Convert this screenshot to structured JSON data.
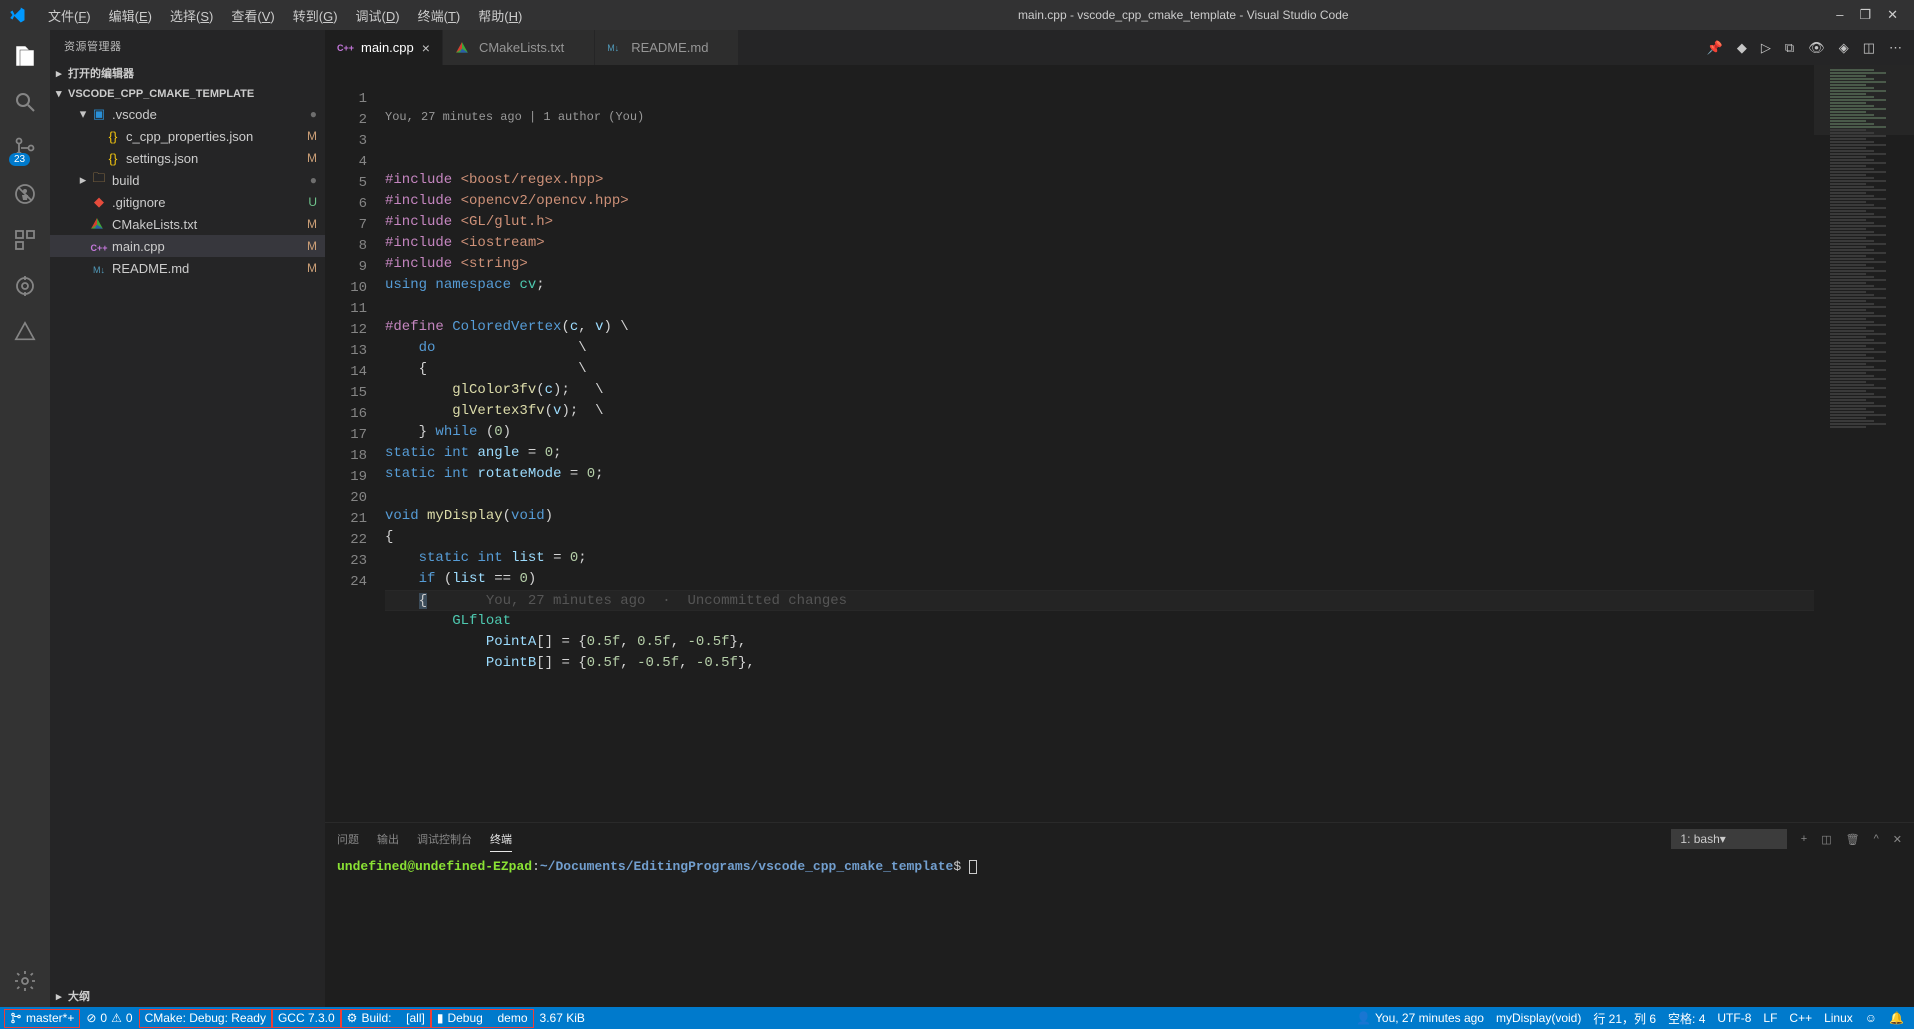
{
  "window": {
    "title": "main.cpp - vscode_cpp_cmake_template - Visual Studio Code"
  },
  "menubar": {
    "items": [
      {
        "pre": "文件(",
        "accel": "F",
        "post": ")"
      },
      {
        "pre": "编辑(",
        "accel": "E",
        "post": ")"
      },
      {
        "pre": "选择(",
        "accel": "S",
        "post": ")"
      },
      {
        "pre": "查看(",
        "accel": "V",
        "post": ")"
      },
      {
        "pre": "转到(",
        "accel": "G",
        "post": ")"
      },
      {
        "pre": "调试(",
        "accel": "D",
        "post": ")"
      },
      {
        "pre": "终端(",
        "accel": "T",
        "post": ")"
      },
      {
        "pre": "帮助(",
        "accel": "H",
        "post": ")"
      }
    ]
  },
  "activitybar": {
    "scm_badge": "23"
  },
  "sidebar": {
    "title": "资源管理器",
    "sections": {
      "open_editors": "打开的编辑器",
      "workspace": "VSCODE_CPP_CMAKE_TEMPLATE",
      "outline": "大纲"
    },
    "tree": [
      {
        "indent": 1,
        "chevron": "▾",
        "icon": "folder-vscode",
        "label": ".vscode",
        "badge": "●",
        "badgeClass": "dot"
      },
      {
        "indent": 2,
        "chevron": "",
        "icon": "json",
        "label": "c_cpp_properties.json",
        "badge": "M"
      },
      {
        "indent": 2,
        "chevron": "",
        "icon": "json",
        "label": "settings.json",
        "badge": "M"
      },
      {
        "indent": 1,
        "chevron": "▸",
        "icon": "folder",
        "label": "build",
        "badge": "●",
        "badgeClass": "dot"
      },
      {
        "indent": 1,
        "chevron": "",
        "icon": "git",
        "label": ".gitignore",
        "badge": "U",
        "badgeClass": "u"
      },
      {
        "indent": 1,
        "chevron": "",
        "icon": "cmake",
        "label": "CMakeLists.txt",
        "badge": "M"
      },
      {
        "indent": 1,
        "chevron": "",
        "icon": "cpp",
        "label": "main.cpp",
        "badge": "M",
        "selected": true
      },
      {
        "indent": 1,
        "chevron": "",
        "icon": "md",
        "label": "README.md",
        "badge": "M"
      }
    ]
  },
  "tabs": [
    {
      "icon": "cpp",
      "label": "main.cpp",
      "active": true,
      "close": true
    },
    {
      "icon": "cmake",
      "label": "CMakeLists.txt"
    },
    {
      "icon": "md",
      "label": "README.md"
    }
  ],
  "editor": {
    "codelens": "You, 27 minutes ago | 1 author (You)",
    "inline_blame": "You, 27 minutes ago  ·  Uncommitted changes",
    "lines_start": 1,
    "lines_end": 24,
    "code": [
      {
        "html": "<span class='tok-include'>#include</span> <span class='tok-string'>&lt;boost/regex.hpp&gt;</span>"
      },
      {
        "html": "<span class='tok-include'>#include</span> <span class='tok-string'>&lt;opencv2/opencv.hpp&gt;</span>"
      },
      {
        "html": "<span class='tok-include'>#include</span> <span class='tok-string'>&lt;GL/glut.h&gt;</span>"
      },
      {
        "html": "<span class='tok-include'>#include</span> <span class='tok-string'>&lt;iostream&gt;</span>"
      },
      {
        "html": "<span class='tok-include'>#include</span> <span class='tok-string'>&lt;string&gt;</span>"
      },
      {
        "html": "<span class='tok-keyword'>using</span> <span class='tok-keyword'>namespace</span> <span class='tok-type'>cv</span><span class='tok-punct'>;</span>"
      },
      {
        "html": ""
      },
      {
        "html": "<span class='tok-include'>#define</span> <span class='tok-macro'>ColoredVertex</span><span class='tok-punct'>(</span><span class='tok-var'>c</span><span class='tok-punct'>,</span> <span class='tok-var'>v</span><span class='tok-punct'>)</span> <span class='tok-punct'>\\</span>"
      },
      {
        "html": "    <span class='tok-keyword'>do</span>                 <span class='tok-punct'>\\</span>"
      },
      {
        "html": "    <span class='tok-punct'>{</span>                  <span class='tok-punct'>\\</span>"
      },
      {
        "html": "        <span class='tok-func'>glColor3fv</span><span class='tok-punct'>(</span><span class='tok-var'>c</span><span class='tok-punct'>);</span>   <span class='tok-punct'>\\</span>"
      },
      {
        "html": "        <span class='tok-func'>glVertex3fv</span><span class='tok-punct'>(</span><span class='tok-var'>v</span><span class='tok-punct'>);</span>  <span class='tok-punct'>\\</span>"
      },
      {
        "html": "    <span class='tok-punct'>}</span> <span class='tok-keyword'>while</span> <span class='tok-punct'>(</span><span class='tok-num'>0</span><span class='tok-punct'>)</span>"
      },
      {
        "html": "<span class='tok-keyword'>static</span> <span class='tok-keyword'>int</span> <span class='tok-var'>angle</span> <span class='tok-punct'>=</span> <span class='tok-num'>0</span><span class='tok-punct'>;</span>"
      },
      {
        "html": "<span class='tok-keyword'>static</span> <span class='tok-keyword'>int</span> <span class='tok-var'>rotateMode</span> <span class='tok-punct'>=</span> <span class='tok-num'>0</span><span class='tok-punct'>;</span>"
      },
      {
        "html": ""
      },
      {
        "html": "<span class='tok-keyword'>void</span> <span class='tok-func'>myDisplay</span><span class='tok-punct'>(</span><span class='tok-keyword'>void</span><span class='tok-punct'>)</span>"
      },
      {
        "html": "<span class='tok-punct'>{</span>"
      },
      {
        "html": "    <span class='tok-keyword'>static</span> <span class='tok-keyword'>int</span> <span class='tok-var'>list</span> <span class='tok-punct'>=</span> <span class='tok-num'>0</span><span class='tok-punct'>;</span>"
      },
      {
        "html": "    <span class='tok-keyword'>if</span> <span class='tok-punct'>(</span><span class='tok-var'>list</span> <span class='tok-punct'>==</span> <span class='tok-num'>0</span><span class='tok-punct'>)</span>"
      },
      {
        "html": "    <span style='background:#3c4c5a'>{</span>       <span class='inline-hint'>__BLAME__</span>",
        "current": true
      },
      {
        "html": "        <span class='tok-type'>GLfloat</span>"
      },
      {
        "html": "            <span class='tok-var'>PointA</span><span class='tok-punct'>[] = {</span><span class='tok-num'>0.5f</span><span class='tok-punct'>,</span> <span class='tok-num'>0.5f</span><span class='tok-punct'>,</span> <span class='tok-num'>-0.5f</span><span class='tok-punct'>},</span>"
      },
      {
        "html": "            <span class='tok-var'>PointB</span><span class='tok-punct'>[] = {</span><span class='tok-num'>0.5f</span><span class='tok-punct'>,</span> <span class='tok-num'>-0.5f</span><span class='tok-punct'>,</span> <span class='tok-num'>-0.5f</span><span class='tok-punct'>},</span>"
      }
    ]
  },
  "panel": {
    "tabs": {
      "problems": "问题",
      "output": "输出",
      "debug_console": "调试控制台",
      "terminal": "终端"
    },
    "terminal_select": "1: bash",
    "terminal": {
      "user": "undefined",
      "host": "undefined-EZpad",
      "path": "~/Documents/EditingPrograms/vscode_cpp_cmake_template",
      "prompt": "$"
    }
  },
  "statusbar": {
    "branch": "master*+",
    "errors": "0",
    "warnings": "0",
    "cmake_status": "CMake: Debug: Ready",
    "compiler": "GCC 7.3.0",
    "build_label": "Build:",
    "build_target": "[all]",
    "debug_label": "Debug",
    "debug_target": "demo",
    "file_size": "3.67 KiB",
    "blame": "You, 27 minutes ago",
    "context": "myDisplay(void)",
    "ln_col": "行 21，列 6",
    "spaces": "空格: 4",
    "encoding": "UTF-8",
    "eol": "LF",
    "language": "C++",
    "platform": "Linux"
  }
}
